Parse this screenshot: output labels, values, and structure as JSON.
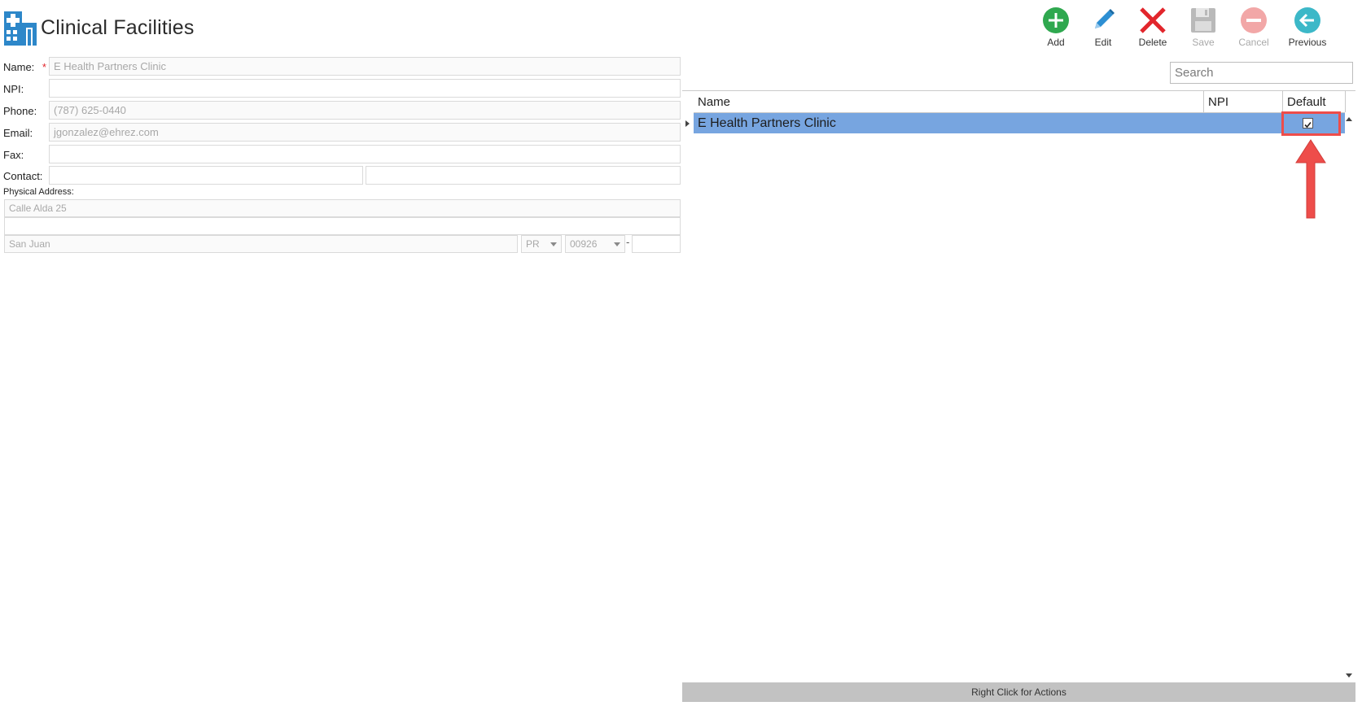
{
  "page": {
    "title": "Clinical Facilities"
  },
  "toolbar": {
    "add_label": "Add",
    "edit_label": "Edit",
    "delete_label": "Delete",
    "save_label": "Save",
    "cancel_label": "Cancel",
    "previous_label": "Previous"
  },
  "form": {
    "name_label": "Name:",
    "required_marker": "*",
    "name_value": "E Health Partners Clinic",
    "npi_label": "NPI:",
    "npi_value": "",
    "phone_label": "Phone:",
    "phone_value": "(787) 625-0440",
    "email_label": "Email:",
    "email_value": "jgonzalez@ehrez.com",
    "fax_label": "Fax:",
    "fax_value": "",
    "contact_label": "Contact:",
    "contact_first": "",
    "contact_last": "",
    "physical_address_label": "Physical Address:",
    "address_line1": "Calle Alda 25",
    "address_line2": "",
    "city": "San Juan",
    "state": "PR",
    "zip": "00926",
    "zip_separator": "-",
    "zip_ext": ""
  },
  "grid": {
    "search_placeholder": "Search",
    "columns": [
      "Name",
      "NPI",
      "Default"
    ],
    "rows": [
      {
        "name": "E Health Partners Clinic",
        "npi": "",
        "default": true
      }
    ],
    "footer": "Right Click for Actions"
  },
  "colors": {
    "selected_row": "#77a5e0",
    "highlight": "#ee4d4a",
    "add": "#2fa84f",
    "edit": "#2d8fd3",
    "delete": "#e2262c",
    "previous": "#3cb8c8"
  },
  "icons": {
    "logo": "hospital-icon",
    "add": "plus-circle-icon",
    "edit": "pencil-icon",
    "delete": "x-icon",
    "save": "floppy-disk-icon",
    "cancel": "minus-circle-icon",
    "previous": "arrow-left-circle-icon"
  }
}
